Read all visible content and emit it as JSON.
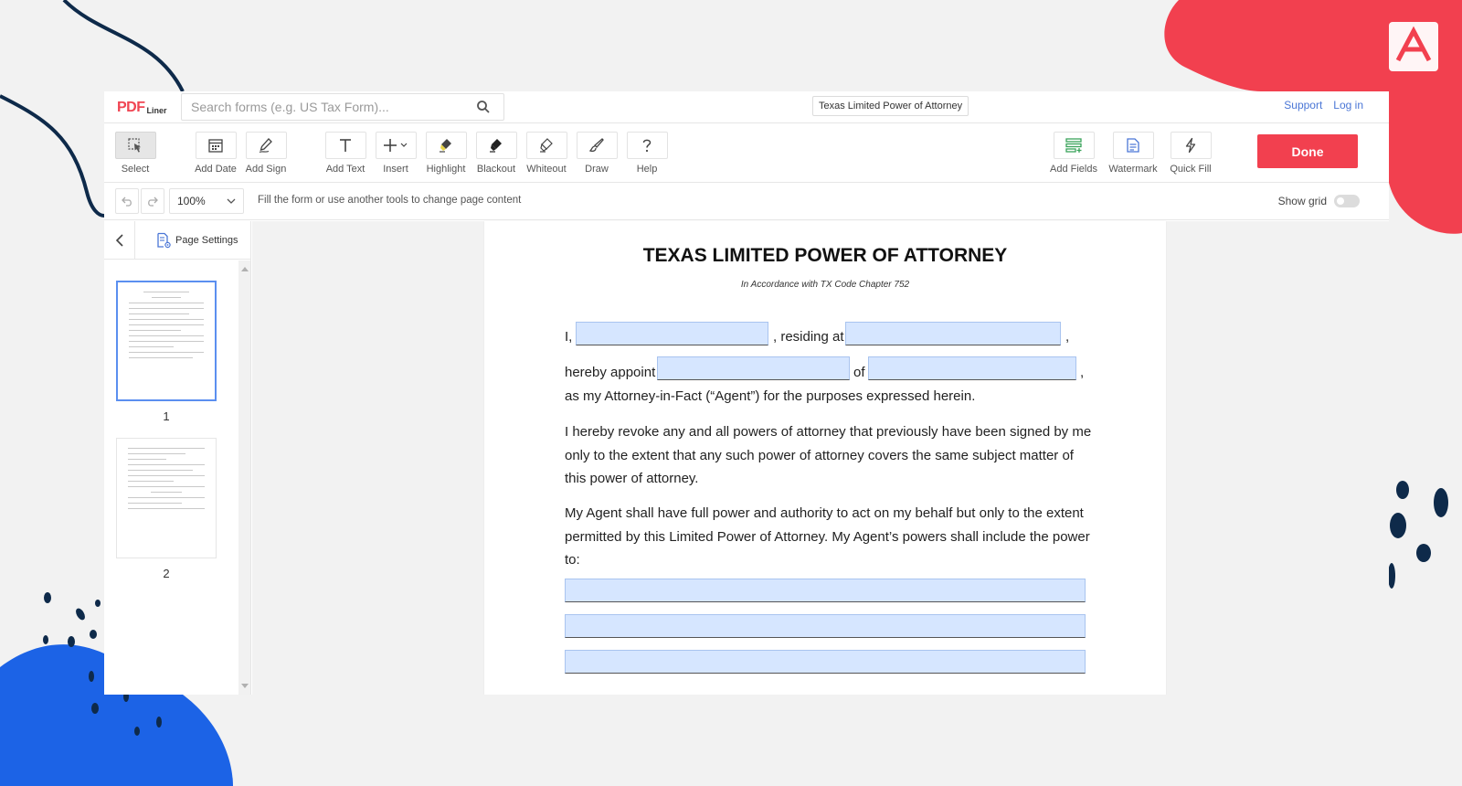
{
  "app": {
    "logo_main": "PDF",
    "logo_sub": "Liner",
    "search_placeholder": "Search forms (e.g. US Tax Form)...",
    "document_title": "Texas Limited Power of Attorney",
    "links": {
      "support": "Support",
      "login": "Log in"
    }
  },
  "toolbar": {
    "tools": [
      {
        "label": "Select",
        "icon": "select-cursor-icon"
      },
      {
        "label": "Add Date",
        "icon": "calendar-icon"
      },
      {
        "label": "Add Sign",
        "icon": "pen-sign-icon"
      },
      {
        "label": "Add Text",
        "icon": "text-t-icon"
      },
      {
        "label": "Insert",
        "icon": "plus-icon"
      },
      {
        "label": "Highlight",
        "icon": "highlighter-icon"
      },
      {
        "label": "Blackout",
        "icon": "blackout-icon"
      },
      {
        "label": "Whiteout",
        "icon": "whiteout-icon"
      },
      {
        "label": "Draw",
        "icon": "brush-icon"
      },
      {
        "label": "Help",
        "icon": "question-icon"
      }
    ],
    "right_tools": [
      {
        "label": "Add Fields",
        "icon": "add-fields-icon"
      },
      {
        "label": "Watermark",
        "icon": "watermark-icon"
      },
      {
        "label": "Quick Fill",
        "icon": "lightning-icon"
      }
    ],
    "done_label": "Done",
    "accent_color": "#f2404f"
  },
  "subbar": {
    "zoom": "100%",
    "hint": "Fill the form or use another tools to change page content",
    "show_grid_label": "Show grid",
    "show_grid": false
  },
  "sidebar": {
    "page_settings_label": "Page Settings",
    "pages": [
      "1",
      "2"
    ],
    "active_page": "1"
  },
  "document": {
    "title": "TEXAS LIMITED POWER OF ATTORNEY",
    "subtitle": "In Accordance with TX Code Chapter 752",
    "line1_prefix": "I,",
    "line1_mid": ", residing at",
    "line1_suffix": ",",
    "line2_prefix": "hereby appoint",
    "line2_mid": "of",
    "line2_suffix": ",",
    "line3": "as my Attorney-in-Fact (“Agent”) for the purposes expressed herein.",
    "para1": "I hereby revoke any and all powers of attorney that previously have been signed by me only to the extent that any such power of attorney covers the same subject matter of this power of attorney.",
    "para2": "My Agent shall have full power and authority to act on my behalf but only to the extent permitted by this Limited Power of Attorney. My Agent’s powers shall include the power to:",
    "field_color": "#d6e6ff"
  }
}
